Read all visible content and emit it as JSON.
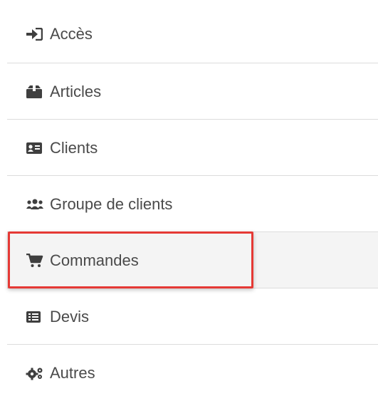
{
  "menu": {
    "items": [
      {
        "label": "Accès",
        "icon": "sign-in-icon"
      },
      {
        "label": "Articles",
        "icon": "box-icon"
      },
      {
        "label": "Clients",
        "icon": "id-card-icon"
      },
      {
        "label": "Groupe de clients",
        "icon": "users-icon"
      },
      {
        "label": "Commandes",
        "icon": "shopping-cart-icon",
        "active": true
      },
      {
        "label": "Devis",
        "icon": "list-icon"
      },
      {
        "label": "Autres",
        "icon": "cogs-icon"
      }
    ]
  },
  "colors": {
    "text": "#4a4a4a",
    "active_background": "#f4f4f4",
    "highlight_border": "#e53935",
    "divider": "#dcdcdc"
  }
}
